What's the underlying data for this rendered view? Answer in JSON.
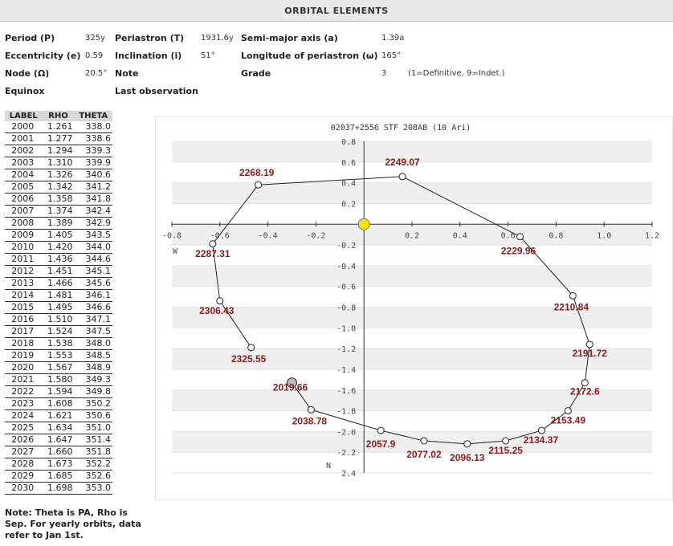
{
  "header": {
    "title": "ORBITAL ELEMENTS"
  },
  "elements": {
    "period": {
      "label": "Period (P)",
      "value": "325y"
    },
    "periastron": {
      "label": "Periastron (T)",
      "value": "1931.6y"
    },
    "semi_major_axis": {
      "label": "Semi-major axis (a)",
      "value": "1.39a"
    },
    "eccentricity": {
      "label": "Eccentricity (e)",
      "value": "0.59"
    },
    "inclination": {
      "label": "Inclination (i)",
      "value": "51°"
    },
    "longitude_periastron": {
      "label": "Longitude of periastron (ω)",
      "value": "165°"
    },
    "node": {
      "label": "Node (Ω)",
      "value": "20.5°"
    },
    "note": {
      "label": "Note",
      "value": ""
    },
    "grade": {
      "label": "Grade",
      "value": "3",
      "extra": "(1=Definitive, 9=Indet.)"
    },
    "equinox": {
      "label": "Equinox",
      "value": ""
    },
    "last_observation": {
      "label": "Last observation",
      "value": ""
    }
  },
  "table": {
    "headers": [
      "LABEL",
      "RHO",
      "THETA"
    ],
    "rows": [
      [
        "2000",
        "1.261",
        "338.0"
      ],
      [
        "2001",
        "1.277",
        "338.6"
      ],
      [
        "2002",
        "1.294",
        "339.3"
      ],
      [
        "2003",
        "1.310",
        "339.9"
      ],
      [
        "2004",
        "1.326",
        "340.6"
      ],
      [
        "2005",
        "1.342",
        "341.2"
      ],
      [
        "2006",
        "1.358",
        "341.8"
      ],
      [
        "2007",
        "1.374",
        "342.4"
      ],
      [
        "2008",
        "1.389",
        "342.9"
      ],
      [
        "2009",
        "1.405",
        "343.5"
      ],
      [
        "2010",
        "1.420",
        "344.0"
      ],
      [
        "2011",
        "1.436",
        "344.6"
      ],
      [
        "2012",
        "1.451",
        "345.1"
      ],
      [
        "2013",
        "1.466",
        "345.6"
      ],
      [
        "2014",
        "1.481",
        "346.1"
      ],
      [
        "2015",
        "1.495",
        "346.6"
      ],
      [
        "2016",
        "1.510",
        "347.1"
      ],
      [
        "2017",
        "1.524",
        "347.5"
      ],
      [
        "2018",
        "1.538",
        "348.0"
      ],
      [
        "2019",
        "1.553",
        "348.5"
      ],
      [
        "2020",
        "1.567",
        "348.9"
      ],
      [
        "2021",
        "1.580",
        "349.3"
      ],
      [
        "2022",
        "1.594",
        "349.8"
      ],
      [
        "2023",
        "1.608",
        "350.2"
      ],
      [
        "2024",
        "1.621",
        "350.6"
      ],
      [
        "2025",
        "1.634",
        "351.0"
      ],
      [
        "2026",
        "1.647",
        "351.4"
      ],
      [
        "2027",
        "1.660",
        "351.8"
      ],
      [
        "2028",
        "1.673",
        "352.2"
      ],
      [
        "2029",
        "1.685",
        "352.6"
      ],
      [
        "2030",
        "1.698",
        "353.0"
      ]
    ]
  },
  "note_text": "Note: Theta is PA, Rho is Sep. For yearly orbits, data refer to Jan 1st.",
  "colors": {
    "header_bg": "#e8e8e8",
    "band": "#efefef",
    "label": "#8b1a1a",
    "primary_star": "#f2e600",
    "line": "#222222"
  },
  "chart_data": {
    "type": "scatter",
    "title": "02037+2556 STF 208AB (10 Ari)",
    "xlabel": "",
    "ylabel": "",
    "xlim": [
      -0.8,
      1.2
    ],
    "ylim": [
      0.8,
      -2.4
    ],
    "x_ticks": [
      -0.8,
      -0.6,
      -0.4,
      -0.2,
      0,
      0.2,
      0.4,
      0.6,
      0.8,
      1.0,
      1.2
    ],
    "x_tick_labels": [
      "-0.8",
      "-0.6",
      "-0.4",
      "-0.2",
      "",
      "0.2",
      "0.4",
      "0.6",
      "0.8",
      "1.0",
      "1.2"
    ],
    "y_ticks": [
      0.8,
      0.6,
      0.4,
      0.2,
      -0.2,
      -0.4,
      -0.6,
      -0.8,
      -1.0,
      -1.2,
      -1.4,
      -1.6,
      -1.8,
      -2.0,
      -2.2,
      -2.4
    ],
    "y_tick_labels": [
      "0.8",
      "0.6",
      "0.4",
      "0.2",
      "-0.2",
      "-0.4",
      "-0.6",
      "-0.8",
      "-1.0",
      "-1.2",
      "-1.4",
      "-1.6",
      "-1.8",
      "-2.0",
      "-2.2",
      "2.4"
    ],
    "axis_letters": {
      "x_axis": "W",
      "y_axis": "N"
    },
    "grid": "horizontal bands",
    "primary": {
      "x": 0.0,
      "y": 0.0
    },
    "current": {
      "label": "2019.66",
      "x": -0.3,
      "y": -1.53
    },
    "orbit": [
      {
        "label": "2249.07",
        "x": 0.16,
        "y": 0.46
      },
      {
        "label": "2229.96",
        "x": 0.65,
        "y": -0.12
      },
      {
        "label": "2210.84",
        "x": 0.87,
        "y": -0.69
      },
      {
        "label": "2191.72",
        "x": 0.94,
        "y": -1.16
      },
      {
        "label": "2172.6",
        "x": 0.92,
        "y": -1.53
      },
      {
        "label": "2153.49",
        "x": 0.85,
        "y": -1.8
      },
      {
        "label": "2134.37",
        "x": 0.74,
        "y": -1.99
      },
      {
        "label": "2115.25",
        "x": 0.59,
        "y": -2.09
      },
      {
        "label": "2096.13",
        "x": 0.43,
        "y": -2.12
      },
      {
        "label": "2077.02",
        "x": 0.25,
        "y": -2.09
      },
      {
        "label": "2057.9",
        "x": 0.07,
        "y": -1.99
      },
      {
        "label": "2038.78",
        "x": -0.22,
        "y": -1.79
      },
      {
        "label": "2019.66",
        "x": -0.3,
        "y": -1.53
      },
      {
        "label": "2325.55",
        "x": -0.47,
        "y": -1.19
      },
      {
        "label": "2306.43",
        "x": -0.6,
        "y": -0.74
      },
      {
        "label": "2287.31",
        "x": -0.63,
        "y": -0.19
      },
      {
        "label": "2268.19",
        "x": -0.44,
        "y": 0.38
      }
    ]
  }
}
